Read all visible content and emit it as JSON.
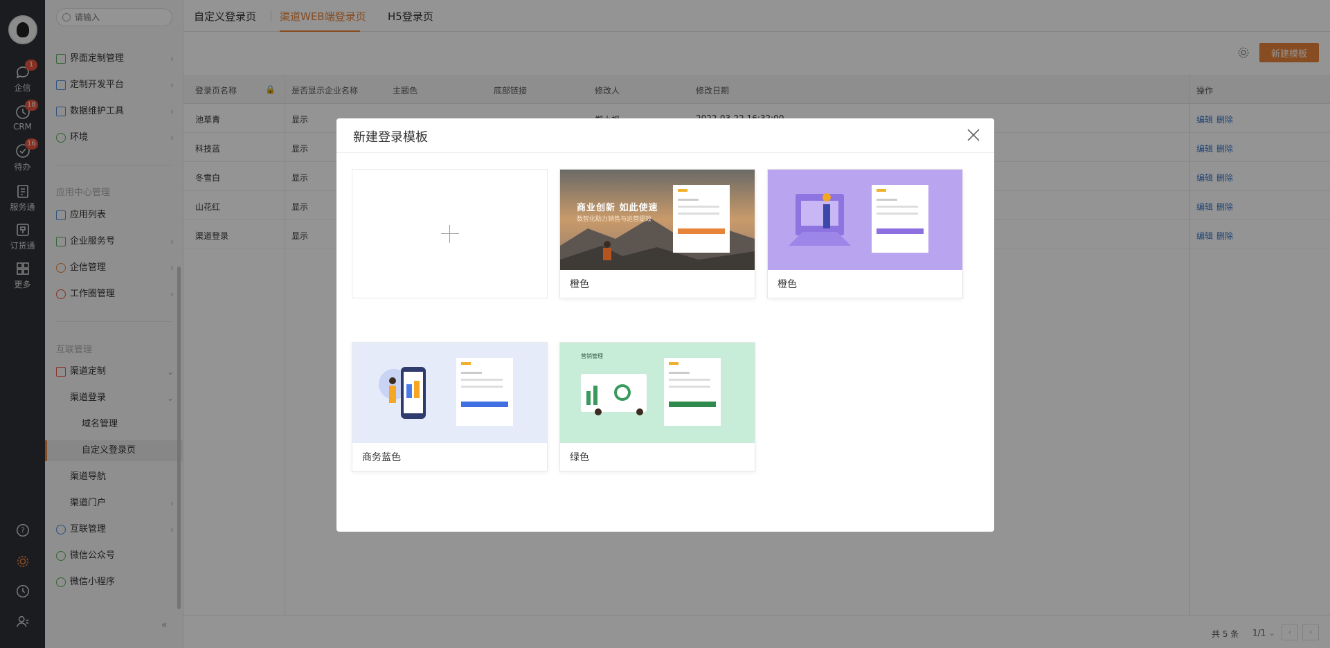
{
  "rail": {
    "items": [
      {
        "label": "企信",
        "badge": "1"
      },
      {
        "label": "CRM",
        "badge": "18"
      },
      {
        "label": "待办",
        "badge": "16"
      },
      {
        "label": "服务通",
        "badge": ""
      },
      {
        "label": "订货通",
        "badge": ""
      },
      {
        "label": "更多",
        "badge": ""
      }
    ]
  },
  "sidenav": {
    "search_placeholder": "请输入",
    "items": [
      {
        "label": "界面定制管理"
      },
      {
        "label": "定制开发平台"
      },
      {
        "label": "数据维护工具"
      },
      {
        "label": "环境"
      }
    ],
    "section_app": "应用中心管理",
    "app_items": [
      {
        "label": "应用列表"
      },
      {
        "label": "企业服务号"
      },
      {
        "label": "企信管理"
      },
      {
        "label": "工作圈管理"
      }
    ],
    "section_link": "互联管理",
    "link_items": [
      {
        "label": "渠道定制"
      },
      {
        "label": "渠道登录"
      },
      {
        "label": "域名管理"
      },
      {
        "label": "自定义登录页"
      },
      {
        "label": "渠道导航"
      },
      {
        "label": "渠道门户"
      },
      {
        "label": "互联管理"
      },
      {
        "label": "微信公众号"
      },
      {
        "label": "微信小程序"
      }
    ]
  },
  "tabs": [
    {
      "label": "自定义登录页"
    },
    {
      "label": "渠道WEB端登录页"
    },
    {
      "label": "H5登录页"
    }
  ],
  "toolbar": {
    "new_label": "新建模板"
  },
  "table": {
    "headers": [
      "登录页名称",
      "是否显示企业名称",
      "主题色",
      "底部链接",
      "修改人",
      "修改日期",
      "操作"
    ],
    "rows": [
      {
        "name": "池草青",
        "show": "显示",
        "link": "--",
        "editor": "郑小祖",
        "date": "2022-03-22 16:32:00"
      },
      {
        "name": "科技蓝",
        "show": "显示"
      },
      {
        "name": "冬雪白",
        "show": "显示"
      },
      {
        "name": "山花红",
        "show": "显示"
      },
      {
        "name": "渠道登录",
        "show": "显示"
      }
    ],
    "edit_label": "编辑",
    "delete_label": "删除"
  },
  "footer": {
    "total": "共 5 条",
    "page": "1/1"
  },
  "modal": {
    "title": "新建登录模板",
    "templates": [
      {
        "name": ""
      },
      {
        "name": "橙色",
        "banner": "商业创新 如此使速",
        "subtext": "数智化助力销售与运营提效"
      },
      {
        "name": "橙色"
      },
      {
        "name": "商务蓝色"
      },
      {
        "name": "绿色",
        "banner": "营销管理"
      }
    ]
  },
  "colors": {
    "accent": "#e8833a",
    "link": "#3a78c9",
    "rail": "#2f3137"
  }
}
